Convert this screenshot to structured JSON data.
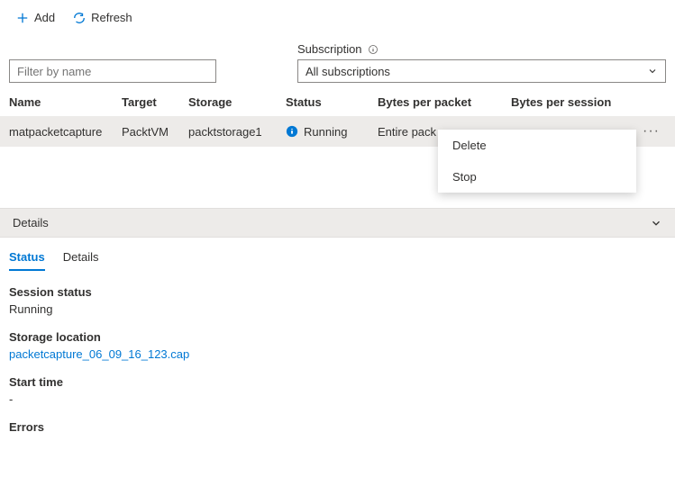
{
  "toolbar": {
    "add_label": "Add",
    "refresh_label": "Refresh"
  },
  "filter": {
    "placeholder": "Filter by name"
  },
  "subscription": {
    "label": "Subscription",
    "selected": "All subscriptions"
  },
  "columns": {
    "name": "Name",
    "target": "Target",
    "storage": "Storage",
    "status": "Status",
    "bytes_packet": "Bytes per packet",
    "bytes_session": "Bytes per session"
  },
  "rows": [
    {
      "name": "matpacketcapture",
      "target": "PacktVM",
      "storage": "packtstorage1",
      "status": "Running",
      "bytes_packet": "Entire pack",
      "bytes_session": ""
    }
  ],
  "context_menu": {
    "delete": "Delete",
    "stop": "Stop"
  },
  "details_bar": "Details",
  "tabs": {
    "status": "Status",
    "details": "Details"
  },
  "detail": {
    "session_status_label": "Session status",
    "session_status_value": "Running",
    "storage_location_label": "Storage location",
    "storage_location_value": "packetcapture_06_09_16_123.cap",
    "start_time_label": "Start time",
    "start_time_value": "-",
    "errors_label": "Errors"
  }
}
